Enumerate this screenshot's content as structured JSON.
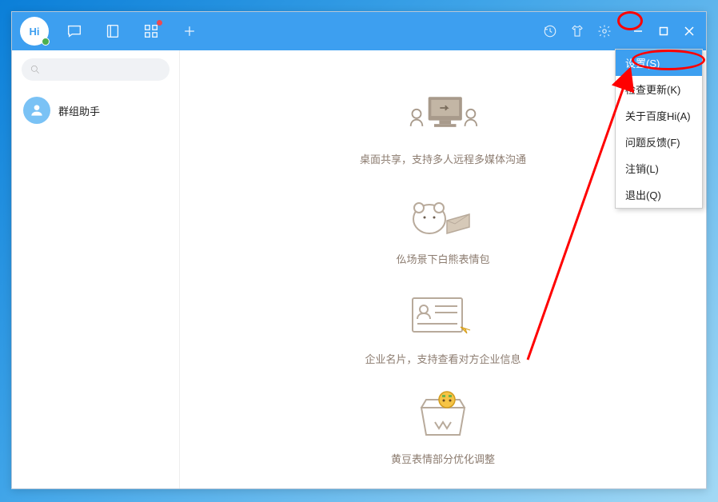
{
  "app": {
    "logo_text": "Hi"
  },
  "titlebar": {
    "nav": [
      "chat",
      "contacts",
      "apps",
      "add"
    ]
  },
  "sidebar": {
    "items": [
      {
        "label": "群组助手"
      }
    ]
  },
  "main": {
    "features": [
      {
        "caption": "桌面共享，支持多人远程多媒体沟通"
      },
      {
        "caption": "仫场景下白熊表情包"
      },
      {
        "caption": "企业名片，支持查看对方企业信息"
      },
      {
        "caption": "黄豆表情部分优化调整"
      }
    ]
  },
  "menu": {
    "items": [
      {
        "label": "设置(S)",
        "selected": true
      },
      {
        "label": "检查更新(K)"
      },
      {
        "label": "关于百度Hi(A)"
      },
      {
        "label": "问题反馈(F)"
      },
      {
        "label": "注销(L)"
      },
      {
        "label": "退出(Q)"
      }
    ]
  }
}
